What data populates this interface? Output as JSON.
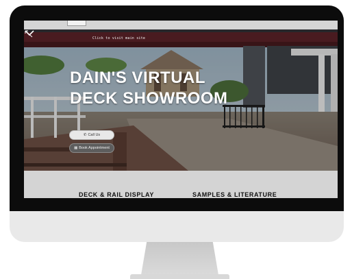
{
  "hero": {
    "hint_text": "Click to visit main site",
    "title_line1": "DAIN'S VIRTUAL",
    "title_line2": "DECK SHOWROOM",
    "call_button": "Call Us",
    "book_button": "Book Appointment"
  },
  "nav": {
    "link1": "DECK & RAIL DISPLAY",
    "link2": "SAMPLES & LITERATURE"
  },
  "icons": {
    "hint": "pointer-arrow-icon",
    "call": "phone-icon",
    "book": "calendar-icon",
    "scroll": "chevron-down-icon"
  }
}
